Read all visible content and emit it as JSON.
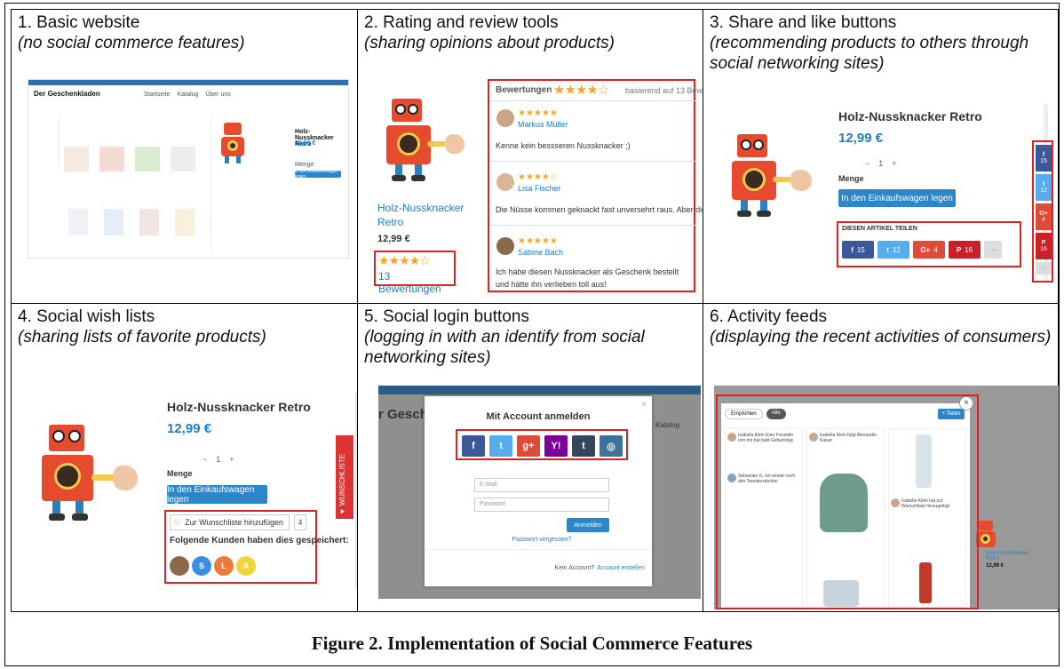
{
  "figure_caption": "Figure 2. Implementation of Social Commerce Features",
  "panels": [
    {
      "title": "1. Basic website",
      "subtitle": "(no social commerce features)"
    },
    {
      "title": "2. Rating and review tools",
      "subtitle": "(sharing opinions about products)"
    },
    {
      "title": "3. Share and like buttons",
      "subtitle": "(recommending products to others through social networking sites)"
    },
    {
      "title": "4. Social wish lists",
      "subtitle": "(sharing lists of favorite products)"
    },
    {
      "title": "5. Social login buttons",
      "subtitle": "(logging in with an identify from social networking sites)"
    },
    {
      "title": "6. Activity feeds",
      "subtitle": "(displaying the recent activities of consumers)"
    }
  ],
  "p1": {
    "shop_name": "Der Geschenkladen",
    "product": "Holz-Nussknacker Retro",
    "price": "12,99 €",
    "qty_label": "Menge",
    "cart_btn": "In den Einkaufswagen legen",
    "nav": [
      "Startseite",
      "Katalog",
      "Über uns"
    ]
  },
  "p2": {
    "reviews_title": "Bewertungen",
    "based_on": "basierend auf 13 Bewertu",
    "product": "Holz-Nussknacker Retro",
    "price": "12,99 €",
    "review_count_link": "13 Bewertungen",
    "reviews": [
      {
        "name": "Markus Müller",
        "text": "Kenne kein bessseren Nussknacker ;)",
        "stars": "★★★★★"
      },
      {
        "name": "Lisa Fischer",
        "text": "Die Nüsse kommen geknackt fast unversehrt raus. Aber die Nuss",
        "stars": "★★★★☆"
      },
      {
        "name": "Sabine Bach",
        "text": "Ich habe diesen Nussknacker als Geschenk bestellt und hätte ihn verlieben toll aus!",
        "stars": "★★★★★"
      }
    ],
    "header_stars": "★★★★☆",
    "rating_stars": "★★★★☆"
  },
  "p3": {
    "product": "Holz-Nussknacker Retro",
    "price": "12,99 €",
    "qty_label": "Menge",
    "qty": "1",
    "minus": "−",
    "plus": "+",
    "cart_btn": "In den Einkaufswagen legen",
    "share_title": "DIESEN ARTIKEL TEILEN",
    "share_buttons": [
      {
        "icon": "f",
        "count": "15",
        "color": "#3b5998"
      },
      {
        "icon": "t",
        "count": "12",
        "color": "#55acee"
      },
      {
        "icon": "G+",
        "count": "4",
        "color": "#dd4b39"
      },
      {
        "icon": "P",
        "count": "16",
        "color": "#cb2027"
      }
    ],
    "more": "···",
    "side_buttons": [
      {
        "icon": "f",
        "count": "15",
        "color": "#3b5998"
      },
      {
        "icon": "t",
        "count": "12",
        "color": "#55acee"
      },
      {
        "icon": "G+",
        "count": "4",
        "color": "#dd4b39"
      },
      {
        "icon": "P",
        "count": "16",
        "color": "#cb2027"
      }
    ]
  },
  "p4": {
    "product": "Holz-Nussknacker Retro",
    "price": "12,99 €",
    "qty_label": "Menge",
    "qty": "1",
    "minus": "−",
    "plus": "+",
    "cart_btn": "In den Einkaufswagen legen",
    "wishlist_btn": "Zur Wunschliste hinzufügen",
    "wishlist_count": "4",
    "saved_by": "Folgende Kunden haben dies gespeichert:",
    "side_tab": "WUNSCHLISTE",
    "avatars": [
      {
        "letter": "",
        "color": "#8a6a4a"
      },
      {
        "letter": "S",
        "color": "#3b8fe0"
      },
      {
        "letter": "L",
        "color": "#f07a3a"
      },
      {
        "letter": "A",
        "color": "#f2d33a"
      }
    ]
  },
  "p5": {
    "modal_title": "Mit Account anmelden",
    "email_placeholder": "E-Mail",
    "password_placeholder": "Passwort",
    "login_btn": "Anmelden",
    "forgot": "Passwort vergessen?",
    "no_account": "Kein Account?",
    "create_account": "Account erstellen",
    "bg_title": "r Gesche",
    "bg_nav": "Katalog",
    "social": [
      {
        "icon": "f",
        "color": "#3b5998"
      },
      {
        "icon": "t",
        "color": "#55acee"
      },
      {
        "icon": "g+",
        "color": "#dd4b39"
      },
      {
        "icon": "Y!",
        "color": "#7b0099"
      },
      {
        "icon": "t",
        "color": "#35465c"
      },
      {
        "icon": "◎",
        "color": "#3f729b"
      }
    ]
  },
  "p6": {
    "tab1": "Empfohlen",
    "tab2": "Alle",
    "follow_btn": "+ Teilen",
    "bg_product": "Holz-Nussknacker Retro",
    "bg_price": "12,99 €",
    "feed_items": [
      {
        "user": "Isabella Klein",
        "text": "Isabella Klein Eine Freundin von mir hat bald Geburtstag"
      },
      {
        "user": "Sebastian G.",
        "text": "Sebastian G. Ich würde noch den Tomatenstecker"
      },
      {
        "user": "Isabella Klein",
        "text": "Isabella Klein folgt Alexander Kaiser"
      },
      {
        "user": "Isabella Klein",
        "text": "Isabella Klein hat zur Wunschliste hinzugefügt"
      }
    ],
    "close": "×"
  }
}
